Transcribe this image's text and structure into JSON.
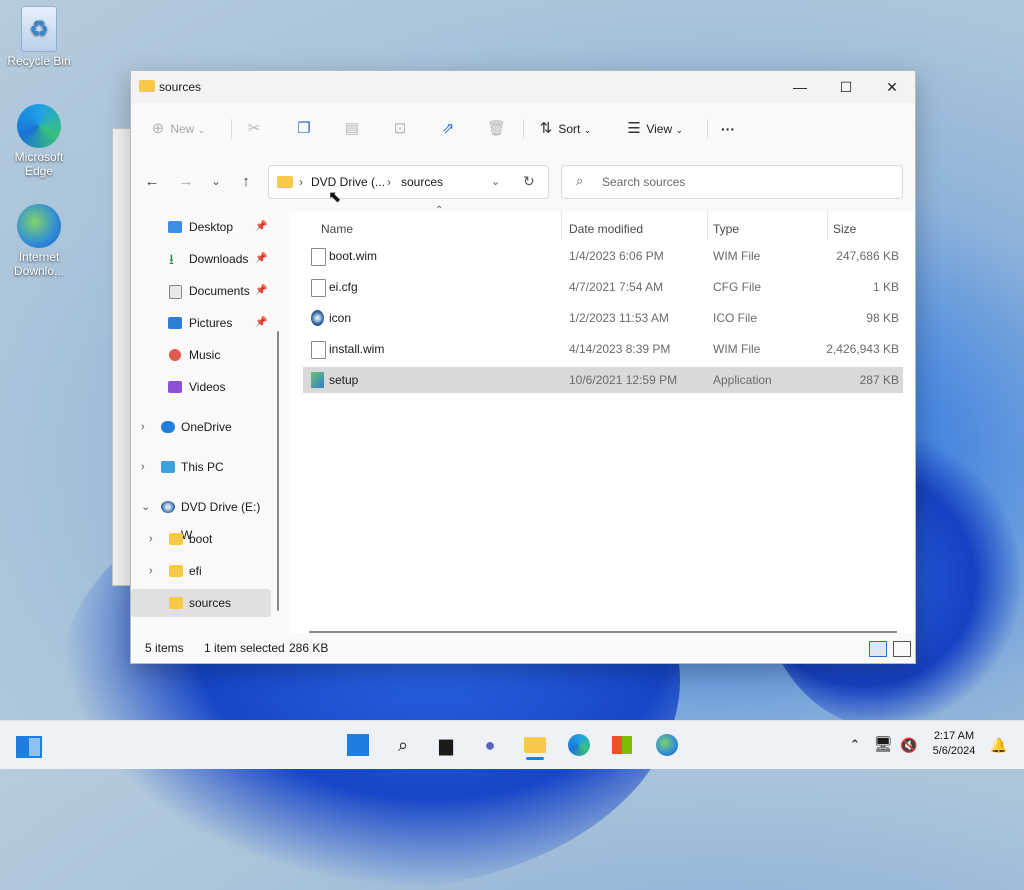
{
  "desktop": {
    "icons": [
      {
        "label": "Recycle Bin"
      },
      {
        "label": "Microsoft Edge"
      },
      {
        "label": "Internet Downlo..."
      }
    ]
  },
  "window": {
    "title": "sources",
    "controls": {
      "minimize": "—",
      "maximize": "☐",
      "close": "✕"
    }
  },
  "toolbar": {
    "new_label": "New",
    "sort_label": "Sort",
    "view_label": "View",
    "more_label": "···"
  },
  "address": {
    "segments": [
      "DVD Drive (...",
      "sources"
    ],
    "search_placeholder": "Search sources"
  },
  "sidebar": {
    "items": [
      {
        "label": "Desktop",
        "pinned": true
      },
      {
        "label": "Downloads",
        "pinned": true
      },
      {
        "label": "Documents",
        "pinned": true
      },
      {
        "label": "Pictures",
        "pinned": true
      },
      {
        "label": "Music"
      },
      {
        "label": "Videos"
      },
      {
        "label": "OneDrive"
      },
      {
        "label": "This PC"
      },
      {
        "label": "DVD Drive (E:) W"
      },
      {
        "label": "boot"
      },
      {
        "label": "efi"
      },
      {
        "label": "sources",
        "selected": true
      }
    ]
  },
  "files": {
    "columns": [
      "Name",
      "Date modified",
      "Type",
      "Size"
    ],
    "rows": [
      {
        "name": "boot.wim",
        "date": "1/4/2023 6:06 PM",
        "type": "WIM File",
        "size": "247,686 KB"
      },
      {
        "name": "ei.cfg",
        "date": "4/7/2021 7:54 AM",
        "type": "CFG File",
        "size": "1 KB"
      },
      {
        "name": "icon",
        "date": "1/2/2023 11:53 AM",
        "type": "ICO File",
        "size": "98 KB"
      },
      {
        "name": "install.wim",
        "date": "4/14/2023 8:39 PM",
        "type": "WIM File",
        "size": "2,426,943 KB"
      },
      {
        "name": "setup",
        "date": "10/6/2021 12:59 PM",
        "type": "Application",
        "size": "287 KB",
        "selected": true
      }
    ]
  },
  "status": {
    "items_count": "5 items",
    "selection": "1 item selected",
    "selection_size": "286 KB"
  },
  "taskbar": {
    "time": "2:17 AM",
    "date": "5/6/2024"
  },
  "colors": {
    "accent": "#2a6fc9",
    "folder": "#f7c948",
    "selection": "#d9d9d9"
  }
}
